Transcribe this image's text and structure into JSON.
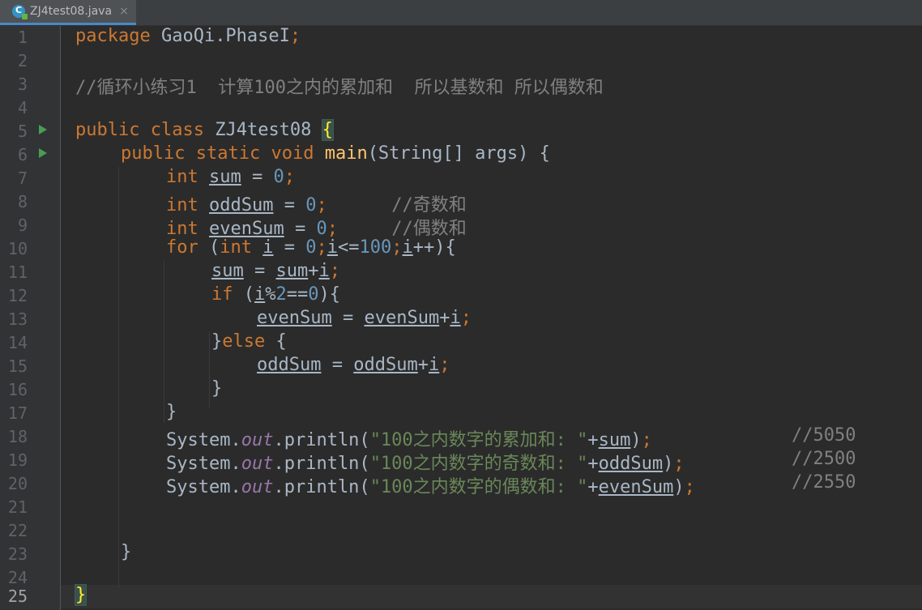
{
  "tab": {
    "icon": "java-class-icon",
    "icon_letter": "C",
    "filename": "ZJ4test08.java",
    "close": "×"
  },
  "gutter": {
    "line_numbers": [
      "1",
      "2",
      "3",
      "4",
      "5",
      "6",
      "7",
      "8",
      "9",
      "10",
      "11",
      "12",
      "13",
      "14",
      "15",
      "16",
      "17",
      "18",
      "19",
      "20",
      "21",
      "22",
      "23",
      "24",
      "25"
    ]
  },
  "code": {
    "l1_kw": "package",
    "l1_rest": " GaoQi.PhaseI",
    "l1_semi": ";",
    "l3": "//循环小练习1  计算100之内的累加和  所以基数和 所以偶数和",
    "l5_public": "public",
    "l5_class": "class",
    "l5_name": " ZJ4test08 ",
    "l5_brace": "{",
    "l6_public": "public",
    "l6_static": "static",
    "l6_void": "void",
    "l6_main": "main",
    "l6_params": "(String[] args) {",
    "l7_int": "int",
    "l7_var": "sum",
    "l7_eq": " = ",
    "l7_val": "0",
    "l7_semi": ";",
    "l8_int": "int",
    "l8_var": "oddSum",
    "l8_eq": " = ",
    "l8_val": "0",
    "l8_semi": ";",
    "l8_cmt": "//奇数和",
    "l9_int": "int",
    "l9_var": "evenSum",
    "l9_eq": " = ",
    "l9_val": "0",
    "l9_semi": ";",
    "l9_cmt": "//偶数和",
    "l10_for": "for",
    "l10_open": " (",
    "l10_int": "int",
    "l10_i1": "i",
    "l10_eq": " = ",
    "l10_zero": "0",
    "l10_s1": ";",
    "l10_i2": "i",
    "l10_le": "<=",
    "l10_hundred": "100",
    "l10_s2": ";",
    "l10_i3": "i",
    "l10_end": "++){",
    "l11_sum1": "sum",
    "l11_eq": " = ",
    "l11_sum2": "sum",
    "l11_plus": "+",
    "l11_i": "i",
    "l11_semi": ";",
    "l12_if": "if",
    "l12_open": " (",
    "l12_i": "i",
    "l12_mod": "%",
    "l12_two": "2",
    "l12_eqeq": "==",
    "l12_zero": "0",
    "l12_close": "){",
    "l13_even1": "evenSum",
    "l13_eq": " = ",
    "l13_even2": "evenSum",
    "l13_plus": "+",
    "l13_i": "i",
    "l13_semi": ";",
    "l14_close": "}",
    "l14_else": "else",
    "l14_open": " {",
    "l15_odd1": "oddSum",
    "l15_eq": " = ",
    "l15_odd2": "oddSum",
    "l15_plus": "+",
    "l15_i": "i",
    "l15_semi": ";",
    "l16": "}",
    "l17": "}",
    "l18_sys": "System.",
    "l18_out": "out",
    "l18_print": ".println(",
    "l18_str": "\"100之内数字的累加和: \"",
    "l18_plus": "+",
    "l18_var": "sum",
    "l18_close": ")",
    "l18_semi": ";",
    "l18_cmt": "//5050",
    "l19_sys": "System.",
    "l19_out": "out",
    "l19_print": ".println(",
    "l19_str": "\"100之内数字的奇数和: \"",
    "l19_plus": "+",
    "l19_var": "oddSum",
    "l19_close": ")",
    "l19_semi": ";",
    "l19_cmt": "//2500",
    "l20_sys": "System.",
    "l20_out": "out",
    "l20_print": ".println(",
    "l20_str": "\"100之内数字的偶数和: \"",
    "l20_plus": "+",
    "l20_var": "evenSum",
    "l20_close": ")",
    "l20_semi": ";",
    "l20_cmt": "//2550",
    "l23": "}",
    "l25": "}"
  },
  "colors": {
    "background": "#2b2b2b",
    "keyword": "#cc7832",
    "number": "#6897bb",
    "string": "#6a8759",
    "comment": "#808080",
    "method": "#ffc66d",
    "static_field": "#9876aa",
    "run_gutter": "#499c54",
    "tab_accent": "#4a88c7"
  }
}
